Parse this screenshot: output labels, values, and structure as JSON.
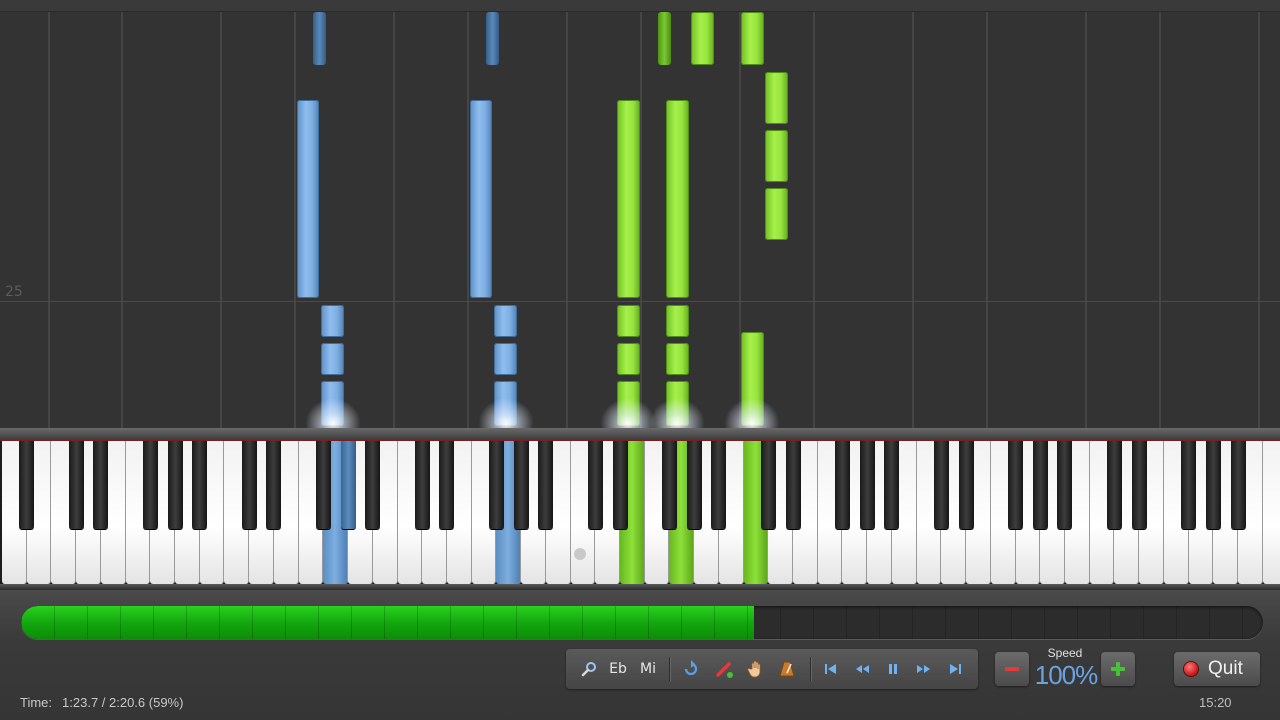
{
  "piano_roll": {
    "measure_number": "25"
  },
  "playback": {
    "progress_fraction": 0.59,
    "time_label": "Time:",
    "time_value": "1:23.7 / 2:20.6 (59%)"
  },
  "toolbar": {
    "key_signature_label": "Eb",
    "note_name_label": "Mi",
    "icons": [
      "search-icon",
      "key-signature",
      "note-names",
      "loop-icon",
      "pencil-icon",
      "hand-icon",
      "metronome-icon",
      "skip-start-icon",
      "rewind-icon",
      "pause-icon",
      "fast-forward-icon",
      "skip-end-icon"
    ]
  },
  "speed": {
    "label": "Speed",
    "value": "100%",
    "decrease": "−",
    "increase": "+"
  },
  "quit": {
    "label": "Quit"
  },
  "clock": "15:20",
  "colors": {
    "left_hand": "#7eaee0",
    "right_hand": "#98e43e",
    "progress": "#13a80e",
    "speed_value": "#6aa3e0"
  }
}
